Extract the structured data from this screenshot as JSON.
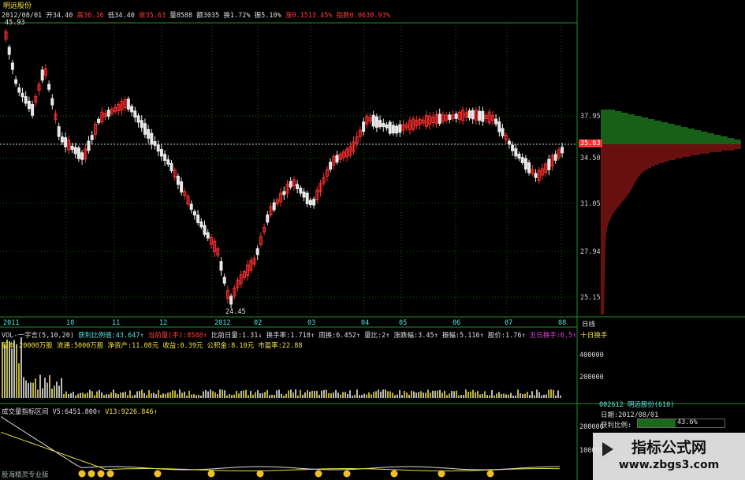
{
  "header": {
    "stock_name": "明远股份",
    "date": "2012/08/01",
    "open": "开34.40",
    "high": "高36.16",
    "low": "低34.40",
    "close": "收35.63",
    "volume": "量8588",
    "amount": "额3035",
    "turnover": "换1.72%",
    "amplitude": "振5.10%",
    "change": "涨0.1513.45%",
    "index": "指数0.0630.93%"
  },
  "price_chart": {
    "max_label": "45.93",
    "min_label": "24.45",
    "y_ticks": [
      "37.95",
      "34.50",
      "31.05",
      "27.94",
      "25.15"
    ],
    "current_price": "35.63",
    "month_labels": [
      "2011",
      "10",
      "11",
      "12",
      "2012",
      "02",
      "03",
      "04",
      "05",
      "06",
      "07",
      "08"
    ],
    "period": "日线",
    "colors": {
      "up": "#ff3030",
      "down": "#e8e8e8",
      "grid": "#0f6a0f",
      "profile_top": "#30c030",
      "profile_bottom": "#d02020"
    }
  },
  "stats_line": {
    "profit_ratio": "获利比例值:43.647↑",
    "cur_volume": "当前量(手):8588↑",
    "volume_ratio_day": "比前日量:1.31↓",
    "turnover_rate": "换手率:1.718↑",
    "week_turnover": "周换:6.452↑",
    "vol_ratio": "量比:2↑",
    "rise_amp": "涨跌幅:3.45↑",
    "amplitude": "振幅:5.116↑",
    "share_price": "股价:1.76↑",
    "five_day": "五日换手:6.5↑",
    "ten_day": "十日换手"
  },
  "volume_panel": {
    "title": "VOL-一字言(5,10,20)",
    "info": "股本:20000万股 流通:5000万股 净资产:11.08元 收益:0.39元 公积金:8.10元 市盈率:22.88",
    "y_ticks": [
      "400000",
      "200000"
    ]
  },
  "indicator_panel": {
    "title": "成交量指标区间",
    "v5": "V5:6451.800↑",
    "v13": "V13:9226.846↑",
    "footer": "股海精灵专业版",
    "y_ticks": [
      "200000",
      "100000"
    ]
  },
  "info_panel": {
    "code_name": "002612 明远股份(610)",
    "date_label": "日期:2012/08/01",
    "profit_label": "获利比例:",
    "profit_value": "43.6%"
  },
  "badge": {
    "title": "指标公式网",
    "url": "www.zbgs3.com"
  }
}
